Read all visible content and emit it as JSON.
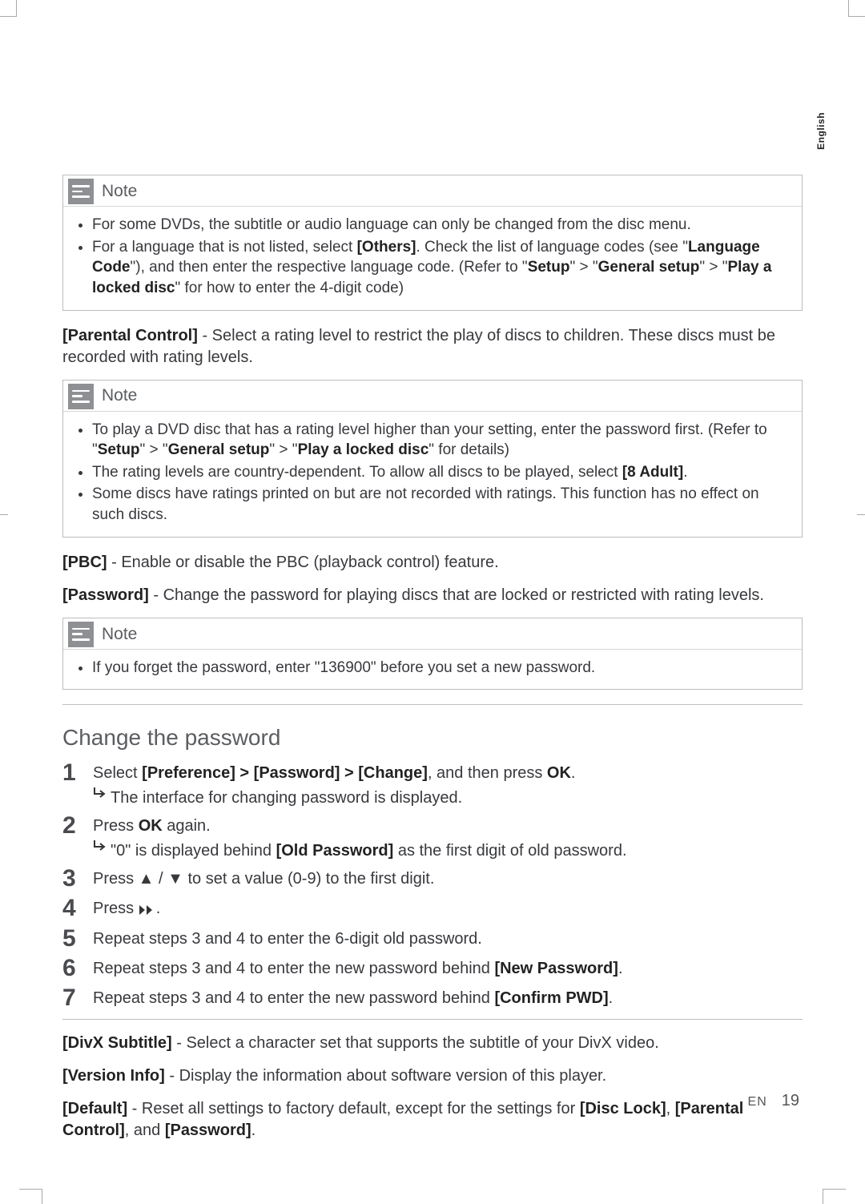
{
  "sideTab": "English",
  "note1": {
    "title": "Note",
    "bullet1_part1": "For some DVDs, the subtitle or audio language can only be changed from the disc menu.",
    "bullet2_pre": "For a language that is not listed, select ",
    "bullet2_opt": "[Others]",
    "bullet2_mid": ". Check the list of language codes (see \"",
    "bullet2_lc": "Language Code",
    "bullet2_mid2": "\"), and then enter the respective language code. (Refer to \"",
    "bullet2_setup": "Setup",
    "bullet2_gt1": "\" > \"",
    "bullet2_gs": "General setup",
    "bullet2_gt2": "\" > \"",
    "bullet2_pld": "Play a locked disc",
    "bullet2_end": "\" for how to enter the 4-digit code)"
  },
  "parental": {
    "label": "[Parental Control]",
    "text": " - Select a rating level to restrict the play of discs to children. These discs must be recorded with rating levels."
  },
  "note2": {
    "title": "Note",
    "b1_pre": "To play a DVD disc that has a rating level higher than your setting, enter the password first. (Refer to \"",
    "b1_setup": "Setup",
    "b1_gt1": "\" > \"",
    "b1_gs": "General setup",
    "b1_gt2": "\" > \"",
    "b1_pld": "Play a locked disc",
    "b1_end": "\" for details)",
    "b2_pre": "The rating levels are country-dependent. To allow all discs to be played, select ",
    "b2_opt": "[8 Adult]",
    "b2_end": ".",
    "b3": "Some discs have ratings printed on but are not recorded with ratings. This function has no effect on such discs."
  },
  "pbc": {
    "label": "[PBC]",
    "text": " - Enable or disable the PBC (playback control) feature."
  },
  "password": {
    "label": "[Password]",
    "text": " - Change the password for playing discs that are locked or restricted with rating levels."
  },
  "note3": {
    "title": "Note",
    "b1": "If you forget the password, enter \"136900\" before you set a new password."
  },
  "changePwd": {
    "heading": "Change the password",
    "s1_pre": "Select ",
    "s1_path": "[Preference] > [Password] > [Change]",
    "s1_mid": ", and then press ",
    "s1_ok": "OK",
    "s1_end": ".",
    "s1_sub": "The interface for changing password is displayed.",
    "s2_pre": "Press ",
    "s2_ok": "OK",
    "s2_end": " again.",
    "s2_sub_pre": "\"0\" is displayed behind ",
    "s2_sub_bold": "[Old Password]",
    "s2_sub_end": " as the first digit of old password.",
    "s3": "Press ▲ / ▼ to set a value (0-9) to the first digit.",
    "s4_pre": "Press ",
    "s4_end": ".",
    "s5": "Repeat steps 3 and 4 to enter the 6-digit old password.",
    "s6_pre": "Repeat steps 3 and 4 to enter the new password behind ",
    "s6_bold": "[New Password]",
    "s6_end": ".",
    "s7_pre": "Repeat steps 3 and 4 to enter the new password behind ",
    "s7_bold": "[Confirm PWD]",
    "s7_end": "."
  },
  "divx": {
    "label": "[DivX Subtitle]",
    "text": " - Select a character set that supports the subtitle of your DivX video."
  },
  "version": {
    "label": "[Version Info]",
    "text": " - Display the information about software version of this player."
  },
  "defaults": {
    "label": "[Default]",
    "text_pre": " - Reset all settings to factory default, except for the settings for ",
    "b1": "[Disc Lock]",
    "sep1": ", ",
    "b2": "[Parental Control]",
    "sep2": ", and ",
    "b3": "[Password]",
    "end": "."
  },
  "footer": {
    "lang": "EN",
    "page": "19"
  }
}
